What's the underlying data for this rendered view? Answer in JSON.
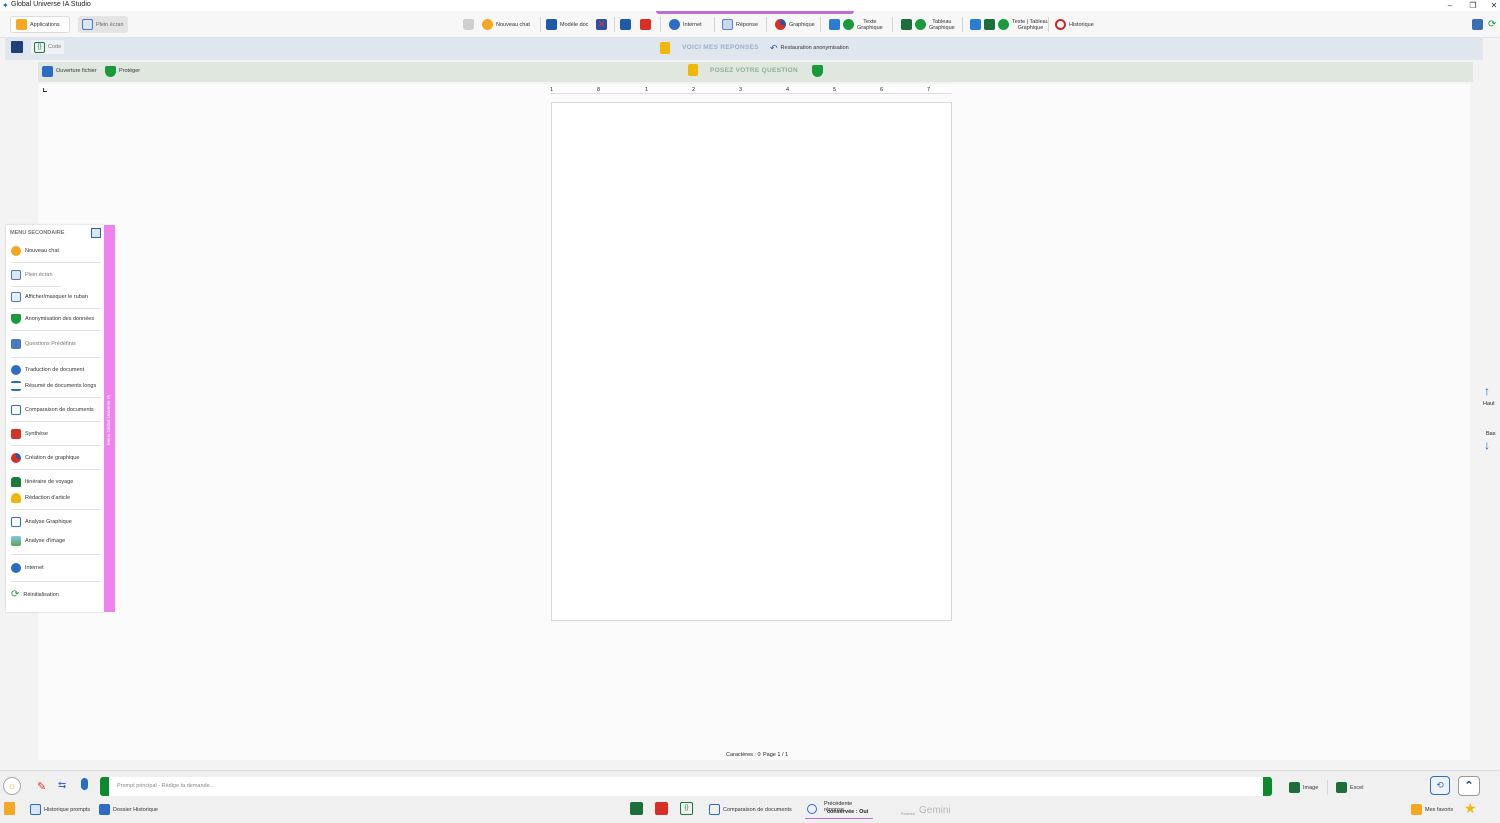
{
  "window": {
    "title": "Global Universe IA Studio"
  },
  "ribbon": {
    "applications": "Applications",
    "fullscreen": "Plein écran",
    "new_chat": "Nouveau chat",
    "template_doc": "Modèle doc",
    "internet": "Internet",
    "response": "Réponse",
    "chart": "Graphique",
    "text_chart": "Texte\nGraphique",
    "table_chart": "Tableau\nGraphique",
    "text_table_chart": "Texte | Tableau\nGraphique",
    "history": "Historique"
  },
  "bar2": {
    "code": "Code",
    "responses_title": "VOICI MES REPONSES",
    "restore": "Restauration anonymisation"
  },
  "bar3": {
    "open_file": "Ouverture fichier",
    "protect": "Protéger",
    "ask_title": "POSEZ VOTRE QUESTION"
  },
  "ruler": {
    "marks": [
      "1",
      "8",
      "1",
      "2",
      "3",
      "4",
      "5",
      "6",
      "7"
    ]
  },
  "status": {
    "characters": "Caractères : 0",
    "page": "Page 1 / 1"
  },
  "nav": {
    "up": "Haut",
    "down": "Bas"
  },
  "side_menu": {
    "title": "MENU SECONDAIRE",
    "strip_label": "Menu Global Universe IA",
    "items": [
      "Nouveau chat",
      "Plein écran",
      "Afficher/masquer le ruban",
      "Anonymisation des données",
      "Questions Prédéfinis",
      "Traduction de document",
      "Résumé de documents longs",
      "Comparaison de documents",
      "Synthèse",
      "Création de graphique",
      "Itinéraire de voyage",
      "Rédaction d'article",
      "Analyse Graphique",
      "Analyse d'image",
      "Internet",
      "Réinitialisation"
    ]
  },
  "bottom": {
    "prompt_placeholder": "Prompt principal - Rédige ta demande...",
    "image": "Image",
    "excel": "Excel",
    "history_prompts": "Historique prompts",
    "history_folder": "Dossier Historique",
    "compare_docs": "Comparaison de documents",
    "previous_response_line1": "Précédente réponse",
    "previous_response_line2": "conservée : Oui",
    "powered": "Powered",
    "gemini": "Gemini",
    "favorites": "Mes favoris"
  },
  "colors": {
    "accent_green": "#0a8a2a",
    "strip_pink": "#ee82ee",
    "blue": "#1565c0"
  }
}
